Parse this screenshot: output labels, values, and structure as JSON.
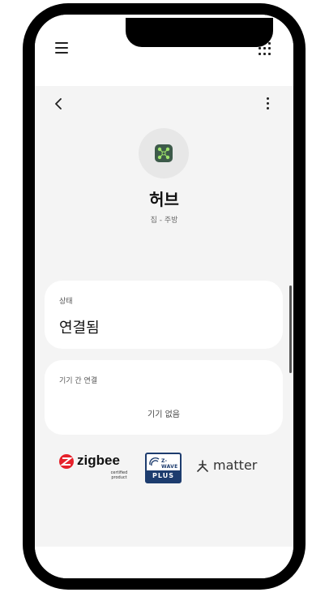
{
  "detail": {
    "title": "허브",
    "subtitle": "집 - 주방"
  },
  "status_card": {
    "label": "상태",
    "value": "연결됨"
  },
  "links_card": {
    "label": "기기 간 연결",
    "empty_text": "기기 없음"
  },
  "logos": {
    "zigbee": {
      "name": "zigbee",
      "sub": "certified product",
      "color": "#e6202a"
    },
    "zwave": {
      "name": "Z-WAVE",
      "plus": "PLUS",
      "color": "#1d3c6e"
    },
    "matter": {
      "name": "matter"
    }
  },
  "icons": {
    "menu": "hamburger-menu-icon",
    "apps": "app-grid-icon",
    "back": "back-arrow-icon",
    "more": "more-vertical-icon",
    "hub": "hub-device-icon"
  },
  "colors": {
    "hub_icon_bg": "#3d5a4a",
    "hub_icon_accent": "#9ee36a"
  }
}
